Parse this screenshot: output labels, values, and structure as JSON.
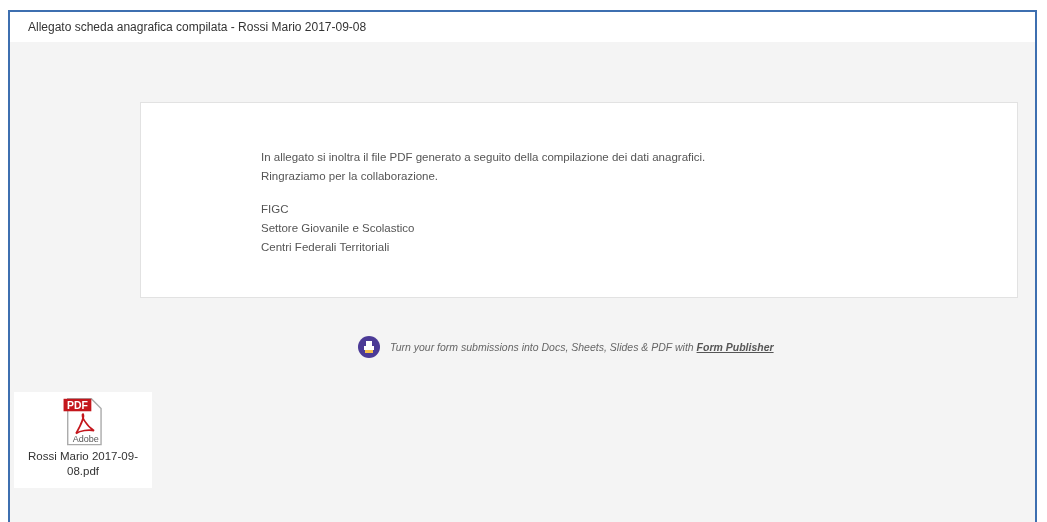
{
  "email": {
    "subject": "Allegato scheda anagrafica compilata - Rossi Mario 2017-09-08",
    "body_paragraphs": [
      [
        "In allegato si inoltra il file PDF generato a seguito della compilazione dei dati anagrafici.",
        "Ringraziamo per la collaborazione."
      ],
      [
        "FIGC",
        "Settore Giovanile e Scolastico",
        "Centri Federali Territoriali"
      ]
    ],
    "footer": {
      "text": "Turn your form submissions into Docs, Sheets, Slides & PDF with ",
      "link": "Form Publisher"
    },
    "attachment": {
      "badge": "PDF",
      "brand": "Adobe",
      "filename": "Rossi Mario 2017-09-08.pdf"
    }
  }
}
